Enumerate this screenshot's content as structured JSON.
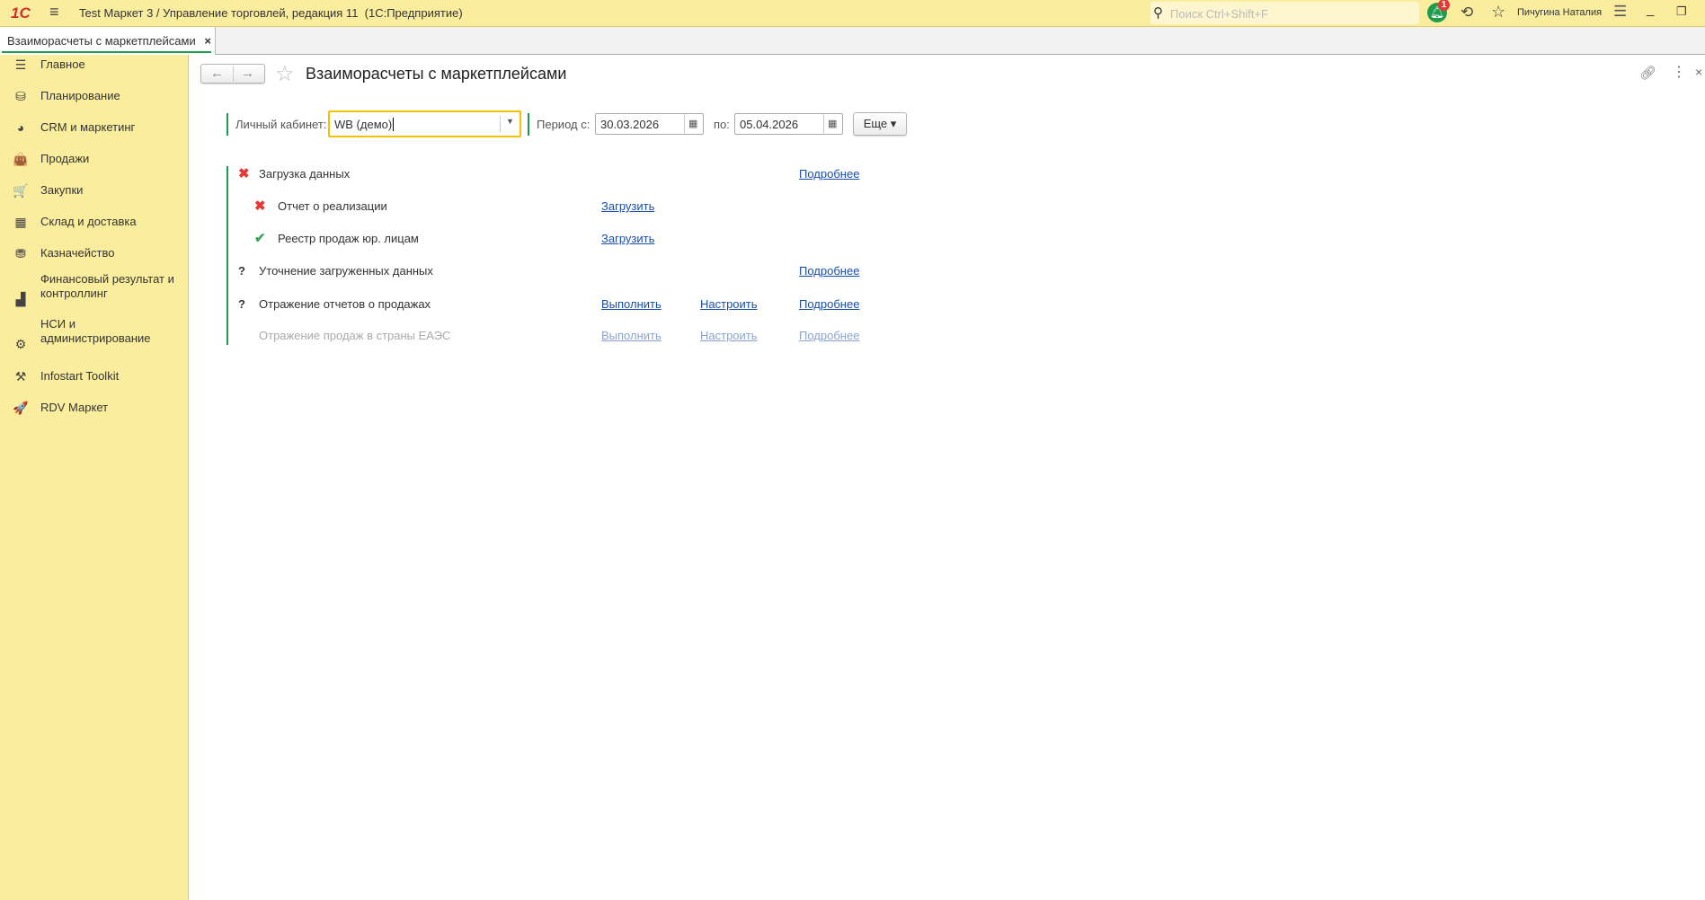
{
  "titlebar": {
    "title": "Test Маркет 3 / Управление торговлей, редакция 11  (1С:Предприятие)",
    "search_placeholder": "Поиск Ctrl+Shift+F",
    "notification_count": "1",
    "user": "Пичугина Наталия"
  },
  "tabs": [
    {
      "label": "Взаиморасчеты с маркетплейсами",
      "close": "×"
    }
  ],
  "sidebar": {
    "items": [
      {
        "label": "Главное",
        "icon": "☰"
      },
      {
        "label": "Планирование",
        "icon": "⛁"
      },
      {
        "label": "CRM и маркетинг",
        "icon": "◕"
      },
      {
        "label": "Продажи",
        "icon": "👜"
      },
      {
        "label": "Закупки",
        "icon": "🛒"
      },
      {
        "label": "Склад и доставка",
        "icon": "▦"
      },
      {
        "label": "Казначейство",
        "icon": "⛃"
      },
      {
        "label": "Финансовый результат и контроллинг",
        "icon": "▟"
      },
      {
        "label": "НСИ и администрирование",
        "icon": "⚙"
      },
      {
        "label": "Infostart Toolkit",
        "icon": "⚒"
      },
      {
        "label": "RDV Маркет",
        "icon": "🚀"
      }
    ]
  },
  "form": {
    "title": "Взаиморасчеты с маркетплейсами",
    "account_label": "Личный кабинет:",
    "account_value": "WB (демо)",
    "period_from_label": "Период с:",
    "period_from": "30.03.2026",
    "period_to_label": "по:",
    "period_to": "05.04.2026",
    "more_label": "Еще ▾"
  },
  "steps": [
    {
      "label": "Загрузка данных",
      "status": "✖",
      "status_color": "#e53935",
      "links": [
        "",
        "",
        "Подробнее"
      ]
    },
    {
      "label": "Отчет о реализации",
      "status": "✖",
      "status_color": "#e53935",
      "links": [
        "Загрузить",
        "",
        ""
      ]
    },
    {
      "label": "Реестр продаж юр. лицам",
      "status": "✔",
      "status_color": "#3aa757",
      "links": [
        "Загрузить",
        "",
        ""
      ]
    },
    {
      "label": "Уточнение загруженных данных",
      "status": "?",
      "status_color": "#333333",
      "links": [
        "",
        "",
        "Подробнее"
      ]
    },
    {
      "label": "Отражение отчетов о продажах",
      "status": "?",
      "status_color": "#333333",
      "links": [
        "Выполнить",
        "Настроить",
        "Подробнее"
      ]
    },
    {
      "label": "Отражение продаж в страны ЕАЭС",
      "status": "",
      "status_color": "#333333",
      "links": [
        "Выполнить",
        "Настроить",
        "Подробнее"
      ],
      "disabled": true
    }
  ]
}
